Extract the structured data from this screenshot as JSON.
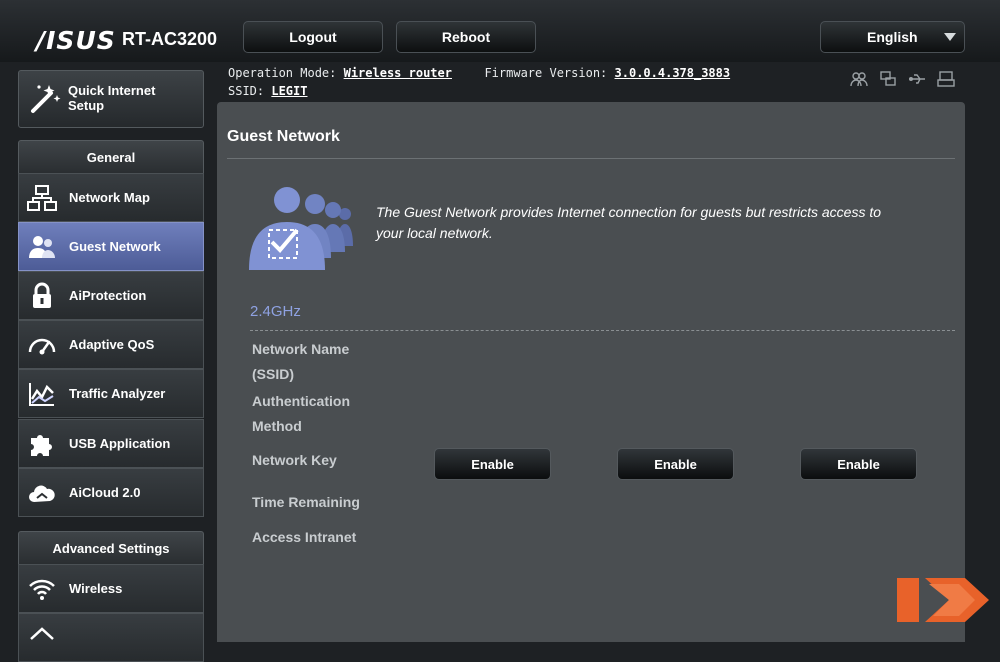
{
  "header": {
    "brand": "/ISUS",
    "model": "RT-AC3200",
    "logout": "Logout",
    "reboot": "Reboot",
    "language": "English"
  },
  "info": {
    "operation_mode_label": "Operation Mode:",
    "operation_mode_value": "Wireless router",
    "firmware_label": "Firmware Version:",
    "firmware_value": "3.0.0.4.378_3883",
    "ssid_label": "SSID:",
    "ssid_value": "LEGIT"
  },
  "sidebar": {
    "qis": "Quick Internet Setup",
    "general_header": "General",
    "items": [
      {
        "label": "Network Map",
        "icon": "network-map-icon"
      },
      {
        "label": "Guest Network",
        "icon": "guest-network-icon",
        "active": true
      },
      {
        "label": "AiProtection",
        "icon": "lock-icon"
      },
      {
        "label": "Adaptive QoS",
        "icon": "speedometer-icon"
      },
      {
        "label": "Traffic Analyzer",
        "icon": "traffic-chart-icon"
      },
      {
        "label": "USB Application",
        "icon": "puzzle-icon"
      },
      {
        "label": "AiCloud 2.0",
        "icon": "cloud-icon"
      }
    ],
    "advanced_header": "Advanced Settings",
    "advanced_items": [
      {
        "label": "Wireless",
        "icon": "wifi-icon"
      }
    ]
  },
  "main": {
    "title": "Guest Network",
    "description": "The Guest Network provides Internet connection for guests but restricts access to your local network.",
    "band": "2.4GHz",
    "fields": {
      "network_name_1": "Network Name",
      "network_name_2": "(SSID)",
      "auth_1": "Authentication",
      "auth_2": "Method",
      "network_key": "Network Key",
      "time_remaining": "Time Remaining",
      "access_intranet": "Access Intranet"
    },
    "enable_buttons": [
      "Enable",
      "Enable",
      "Enable"
    ]
  },
  "colors": {
    "accent": "#8fa2e2",
    "active_nav": "#5e6ea9",
    "panel": "#4a4e51"
  }
}
